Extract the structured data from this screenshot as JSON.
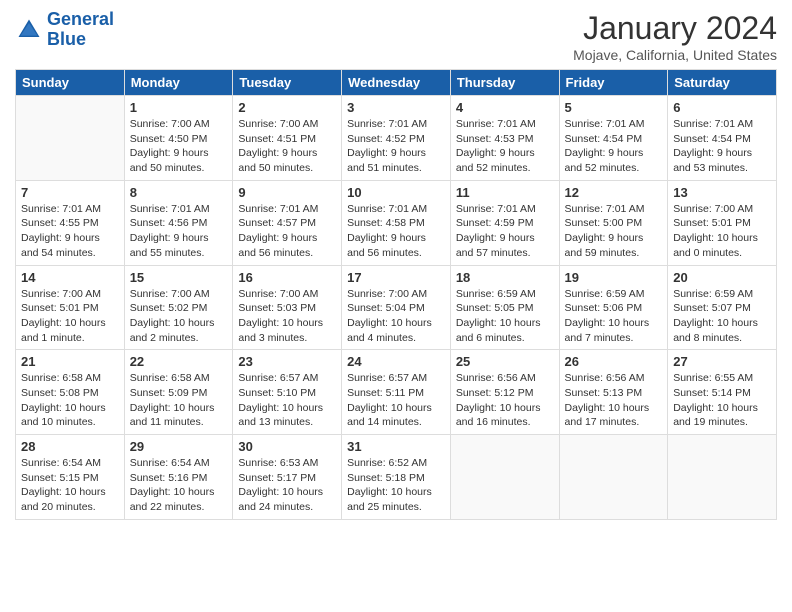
{
  "header": {
    "logo_line1": "General",
    "logo_line2": "Blue",
    "title": "January 2024",
    "subtitle": "Mojave, California, United States"
  },
  "weekdays": [
    "Sunday",
    "Monday",
    "Tuesday",
    "Wednesday",
    "Thursday",
    "Friday",
    "Saturday"
  ],
  "weeks": [
    [
      {
        "day": "",
        "sunrise": "",
        "sunset": "",
        "daylight": ""
      },
      {
        "day": "1",
        "sunrise": "Sunrise: 7:00 AM",
        "sunset": "Sunset: 4:50 PM",
        "daylight": "Daylight: 9 hours and 50 minutes."
      },
      {
        "day": "2",
        "sunrise": "Sunrise: 7:00 AM",
        "sunset": "Sunset: 4:51 PM",
        "daylight": "Daylight: 9 hours and 50 minutes."
      },
      {
        "day": "3",
        "sunrise": "Sunrise: 7:01 AM",
        "sunset": "Sunset: 4:52 PM",
        "daylight": "Daylight: 9 hours and 51 minutes."
      },
      {
        "day": "4",
        "sunrise": "Sunrise: 7:01 AM",
        "sunset": "Sunset: 4:53 PM",
        "daylight": "Daylight: 9 hours and 52 minutes."
      },
      {
        "day": "5",
        "sunrise": "Sunrise: 7:01 AM",
        "sunset": "Sunset: 4:54 PM",
        "daylight": "Daylight: 9 hours and 52 minutes."
      },
      {
        "day": "6",
        "sunrise": "Sunrise: 7:01 AM",
        "sunset": "Sunset: 4:54 PM",
        "daylight": "Daylight: 9 hours and 53 minutes."
      }
    ],
    [
      {
        "day": "7",
        "sunrise": "Sunrise: 7:01 AM",
        "sunset": "Sunset: 4:55 PM",
        "daylight": "Daylight: 9 hours and 54 minutes."
      },
      {
        "day": "8",
        "sunrise": "Sunrise: 7:01 AM",
        "sunset": "Sunset: 4:56 PM",
        "daylight": "Daylight: 9 hours and 55 minutes."
      },
      {
        "day": "9",
        "sunrise": "Sunrise: 7:01 AM",
        "sunset": "Sunset: 4:57 PM",
        "daylight": "Daylight: 9 hours and 56 minutes."
      },
      {
        "day": "10",
        "sunrise": "Sunrise: 7:01 AM",
        "sunset": "Sunset: 4:58 PM",
        "daylight": "Daylight: 9 hours and 56 minutes."
      },
      {
        "day": "11",
        "sunrise": "Sunrise: 7:01 AM",
        "sunset": "Sunset: 4:59 PM",
        "daylight": "Daylight: 9 hours and 57 minutes."
      },
      {
        "day": "12",
        "sunrise": "Sunrise: 7:01 AM",
        "sunset": "Sunset: 5:00 PM",
        "daylight": "Daylight: 9 hours and 59 minutes."
      },
      {
        "day": "13",
        "sunrise": "Sunrise: 7:00 AM",
        "sunset": "Sunset: 5:01 PM",
        "daylight": "Daylight: 10 hours and 0 minutes."
      }
    ],
    [
      {
        "day": "14",
        "sunrise": "Sunrise: 7:00 AM",
        "sunset": "Sunset: 5:01 PM",
        "daylight": "Daylight: 10 hours and 1 minute."
      },
      {
        "day": "15",
        "sunrise": "Sunrise: 7:00 AM",
        "sunset": "Sunset: 5:02 PM",
        "daylight": "Daylight: 10 hours and 2 minutes."
      },
      {
        "day": "16",
        "sunrise": "Sunrise: 7:00 AM",
        "sunset": "Sunset: 5:03 PM",
        "daylight": "Daylight: 10 hours and 3 minutes."
      },
      {
        "day": "17",
        "sunrise": "Sunrise: 7:00 AM",
        "sunset": "Sunset: 5:04 PM",
        "daylight": "Daylight: 10 hours and 4 minutes."
      },
      {
        "day": "18",
        "sunrise": "Sunrise: 6:59 AM",
        "sunset": "Sunset: 5:05 PM",
        "daylight": "Daylight: 10 hours and 6 minutes."
      },
      {
        "day": "19",
        "sunrise": "Sunrise: 6:59 AM",
        "sunset": "Sunset: 5:06 PM",
        "daylight": "Daylight: 10 hours and 7 minutes."
      },
      {
        "day": "20",
        "sunrise": "Sunrise: 6:59 AM",
        "sunset": "Sunset: 5:07 PM",
        "daylight": "Daylight: 10 hours and 8 minutes."
      }
    ],
    [
      {
        "day": "21",
        "sunrise": "Sunrise: 6:58 AM",
        "sunset": "Sunset: 5:08 PM",
        "daylight": "Daylight: 10 hours and 10 minutes."
      },
      {
        "day": "22",
        "sunrise": "Sunrise: 6:58 AM",
        "sunset": "Sunset: 5:09 PM",
        "daylight": "Daylight: 10 hours and 11 minutes."
      },
      {
        "day": "23",
        "sunrise": "Sunrise: 6:57 AM",
        "sunset": "Sunset: 5:10 PM",
        "daylight": "Daylight: 10 hours and 13 minutes."
      },
      {
        "day": "24",
        "sunrise": "Sunrise: 6:57 AM",
        "sunset": "Sunset: 5:11 PM",
        "daylight": "Daylight: 10 hours and 14 minutes."
      },
      {
        "day": "25",
        "sunrise": "Sunrise: 6:56 AM",
        "sunset": "Sunset: 5:12 PM",
        "daylight": "Daylight: 10 hours and 16 minutes."
      },
      {
        "day": "26",
        "sunrise": "Sunrise: 6:56 AM",
        "sunset": "Sunset: 5:13 PM",
        "daylight": "Daylight: 10 hours and 17 minutes."
      },
      {
        "day": "27",
        "sunrise": "Sunrise: 6:55 AM",
        "sunset": "Sunset: 5:14 PM",
        "daylight": "Daylight: 10 hours and 19 minutes."
      }
    ],
    [
      {
        "day": "28",
        "sunrise": "Sunrise: 6:54 AM",
        "sunset": "Sunset: 5:15 PM",
        "daylight": "Daylight: 10 hours and 20 minutes."
      },
      {
        "day": "29",
        "sunrise": "Sunrise: 6:54 AM",
        "sunset": "Sunset: 5:16 PM",
        "daylight": "Daylight: 10 hours and 22 minutes."
      },
      {
        "day": "30",
        "sunrise": "Sunrise: 6:53 AM",
        "sunset": "Sunset: 5:17 PM",
        "daylight": "Daylight: 10 hours and 24 minutes."
      },
      {
        "day": "31",
        "sunrise": "Sunrise: 6:52 AM",
        "sunset": "Sunset: 5:18 PM",
        "daylight": "Daylight: 10 hours and 25 minutes."
      },
      {
        "day": "",
        "sunrise": "",
        "sunset": "",
        "daylight": ""
      },
      {
        "day": "",
        "sunrise": "",
        "sunset": "",
        "daylight": ""
      },
      {
        "day": "",
        "sunrise": "",
        "sunset": "",
        "daylight": ""
      }
    ]
  ]
}
